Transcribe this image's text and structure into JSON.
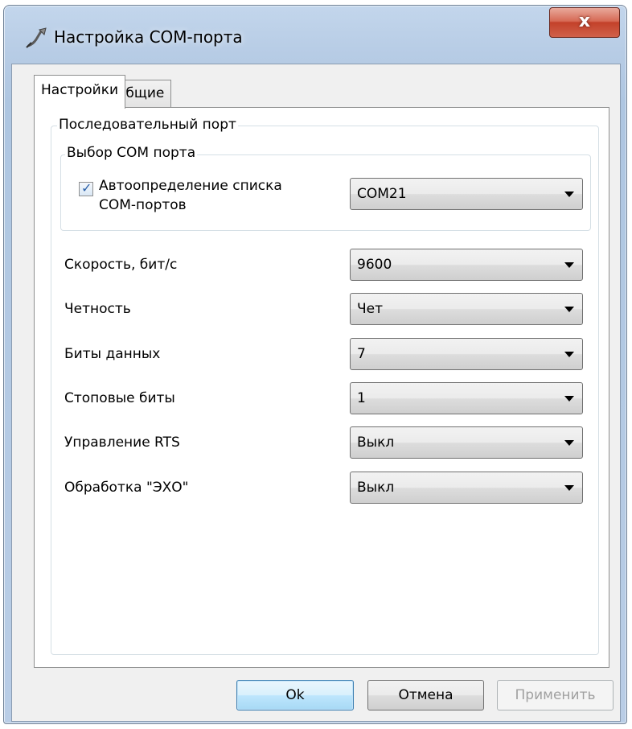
{
  "window": {
    "title": "Настройка COM-порта",
    "close_glyph": "x"
  },
  "tabs": [
    {
      "label": "Настройки",
      "active": true
    },
    {
      "label": "Общие",
      "active": false
    }
  ],
  "serial_port": {
    "group_label": "Последовательный порт",
    "com_select": {
      "group_label": "Выбор COM порта",
      "autodetect_label_line1": "Автоопределение списка",
      "autodetect_label_line2": "COM-портов",
      "autodetect_checked": true,
      "selected_port": "COM21"
    },
    "fields": [
      {
        "label": "Скорость, бит/с",
        "value": "9600"
      },
      {
        "label": "Четность",
        "value": "Чет"
      },
      {
        "label": "Биты данных",
        "value": "7"
      },
      {
        "label": "Стоповые биты",
        "value": "1"
      },
      {
        "label": "Управление RTS",
        "value": "Выкл"
      },
      {
        "label": "Обработка \"ЭХО\"",
        "value": "Выкл"
      }
    ]
  },
  "buttons": {
    "ok": "Ok",
    "cancel": "Отмена",
    "apply": "Применить"
  },
  "colors": {
    "accent": "#3c7fb1",
    "close": "#c3412a"
  }
}
